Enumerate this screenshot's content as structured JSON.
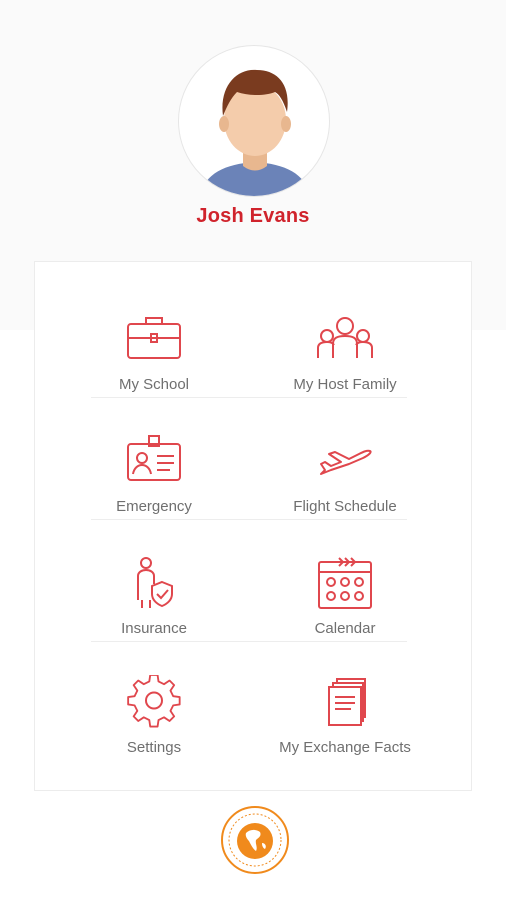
{
  "profile": {
    "name": "Josh Evans",
    "avatar_icon": "user-avatar-icon"
  },
  "menu": [
    {
      "label": "My School",
      "icon": "briefcase-icon"
    },
    {
      "label": "My Host Family",
      "icon": "family-icon"
    },
    {
      "label": "Emergency",
      "icon": "id-card-icon"
    },
    {
      "label": "Flight Schedule",
      "icon": "airplane-icon"
    },
    {
      "label": "Insurance",
      "icon": "person-shield-icon"
    },
    {
      "label": "Calendar",
      "icon": "calendar-icon"
    },
    {
      "label": "Settings",
      "icon": "gear-icon"
    },
    {
      "label": "My Exchange Facts",
      "icon": "documents-icon"
    }
  ],
  "footer": {
    "badge_icon": "explore-the-world-badge-icon"
  },
  "colors": {
    "accent": "#d0232c",
    "icon": "#e0474d",
    "label": "#6f6f6f",
    "badge": "#f08a1c"
  }
}
